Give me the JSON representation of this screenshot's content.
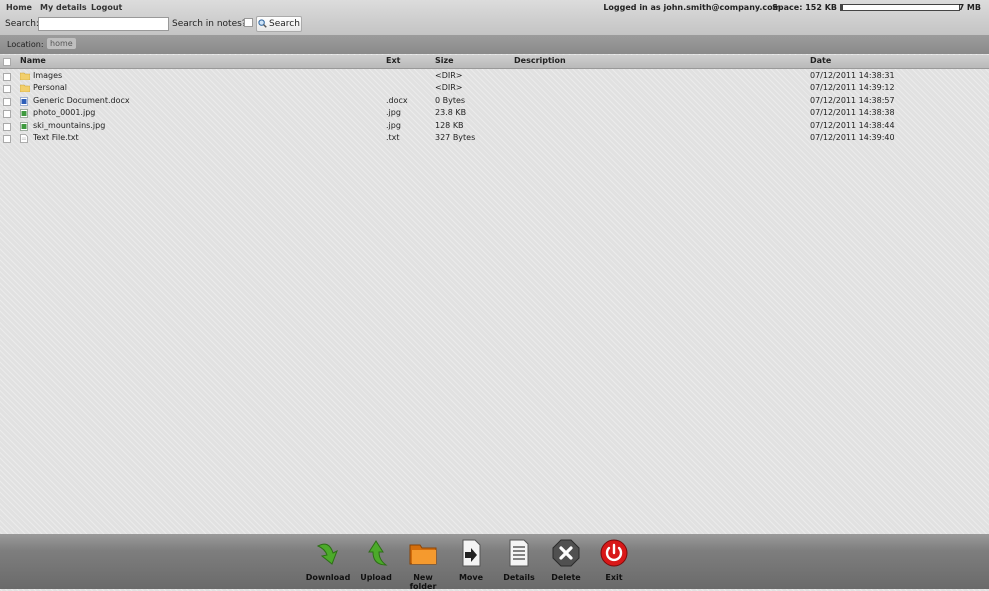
{
  "nav": {
    "home": "Home",
    "my_details": "My details",
    "logout": "Logout"
  },
  "user": {
    "logged_in": "Logged in as john.smith@company.com",
    "space_label": "Space: 152 KB",
    "space_max": "7 MB",
    "space_used_fraction": 0.02
  },
  "search": {
    "label": "Search:",
    "value": "",
    "notes_label": "Search in notes?:",
    "notes_checked": false,
    "button": "Search"
  },
  "location": {
    "label": "Location:",
    "crumb": "home"
  },
  "table": {
    "headers": {
      "name": "Name",
      "ext": "Ext",
      "size": "Size",
      "description": "Description",
      "date": "Date"
    },
    "rows": [
      {
        "icon": "folder-icon",
        "name": "Images",
        "ext": "",
        "size": "<DIR>",
        "description": "",
        "date": "07/12/2011 14:38:31"
      },
      {
        "icon": "folder-icon",
        "name": "Personal",
        "ext": "",
        "size": "<DIR>",
        "description": "",
        "date": "07/12/2011 14:39:12"
      },
      {
        "icon": "word-document-icon",
        "name": "Generic Document.docx",
        "ext": ".docx",
        "size": "0 Bytes",
        "description": "",
        "date": "07/12/2011 14:38:57"
      },
      {
        "icon": "image-file-icon",
        "name": "photo_0001.jpg",
        "ext": ".jpg",
        "size": "23.8 KB",
        "description": "",
        "date": "07/12/2011 14:38:38"
      },
      {
        "icon": "image-file-icon",
        "name": "ski_mountains.jpg",
        "ext": ".jpg",
        "size": "128 KB",
        "description": "",
        "date": "07/12/2011 14:38:44"
      },
      {
        "icon": "text-file-icon",
        "name": "Text File.txt",
        "ext": ".txt",
        "size": "327 Bytes",
        "description": "",
        "date": "07/12/2011 14:39:40"
      }
    ]
  },
  "toolbar": {
    "download": "Download",
    "upload": "Upload",
    "new_folder": "New folder",
    "move": "Move",
    "details": "Details",
    "delete": "Delete",
    "exit": "Exit"
  },
  "colors": {
    "download_green": "#4caa2a",
    "upload_green": "#4caa2a",
    "folder_orange": "#f08a1c",
    "exit_red": "#d81818"
  }
}
